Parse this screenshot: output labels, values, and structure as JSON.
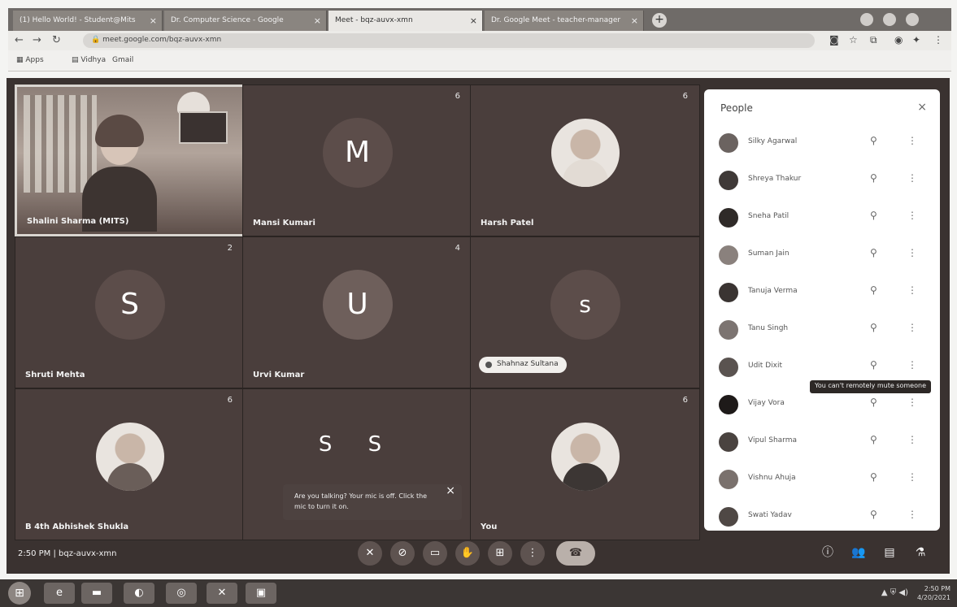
{
  "browser": {
    "tabs": [
      {
        "label": "(1) Hello World! - Student@Mits"
      },
      {
        "label": "Dr. Computer Science - Google"
      },
      {
        "label": "Meet - bqz-auvx-xmn"
      },
      {
        "label": "Dr. Google Meet - teacher-manager"
      }
    ],
    "url": "meet.google.com/bqz-auvx-xmn",
    "bookmarks": [
      "Apps",
      "Vidhya",
      "Gmail"
    ]
  },
  "tiles": [
    {
      "name": "Shalini Sharma (MITS)",
      "type": "video",
      "num": ""
    },
    {
      "name": "Mansi Kumari",
      "type": "letter",
      "letter": "M",
      "num": "6"
    },
    {
      "name": "Harsh Patel",
      "type": "photo",
      "num": "6"
    },
    {
      "name": "Shruti Mehta",
      "type": "letter",
      "letter": "S",
      "num": "2"
    },
    {
      "name": "Urvi Kumar",
      "type": "letter",
      "letter": "U",
      "num": "4"
    },
    {
      "name": "",
      "type": "letter",
      "letter": "s",
      "num": "",
      "pill": "Shahnaz Sultana"
    },
    {
      "name": "B 4th Abhishek Shukla",
      "type": "photo",
      "num": "6"
    },
    {
      "name": "",
      "type": "pair",
      "letters": "S S",
      "num": ""
    },
    {
      "name": "You",
      "type": "photo",
      "num": "6"
    }
  ],
  "toast": {
    "text": "Are you talking? Your mic is off. Click the mic to turn it on.",
    "close": "×"
  },
  "people": {
    "title": "People",
    "close": "×",
    "items": [
      "Silky Agarwal",
      "Shreya Thakur",
      "Sneha Patil",
      "Suman Jain",
      "Tanuja Verma",
      "Tanu Singh",
      "Udit Dixit",
      "Vijay Vora",
      "Vipul Sharma",
      "Vishnu Ahuja",
      "Swati Yadav"
    ],
    "pin_icon": "pin-icon",
    "more_icon": "more-vert-icon"
  },
  "tooltip": "You can't remotely mute someone",
  "controls": {
    "time": "2:50 PM",
    "separator": "|",
    "meeting_code": "bqz-auvx-xmn"
  },
  "taskbar": {
    "time": "2:50 PM",
    "date": "4/20/2021",
    "tray": "▲ ⛨ ◀)"
  }
}
